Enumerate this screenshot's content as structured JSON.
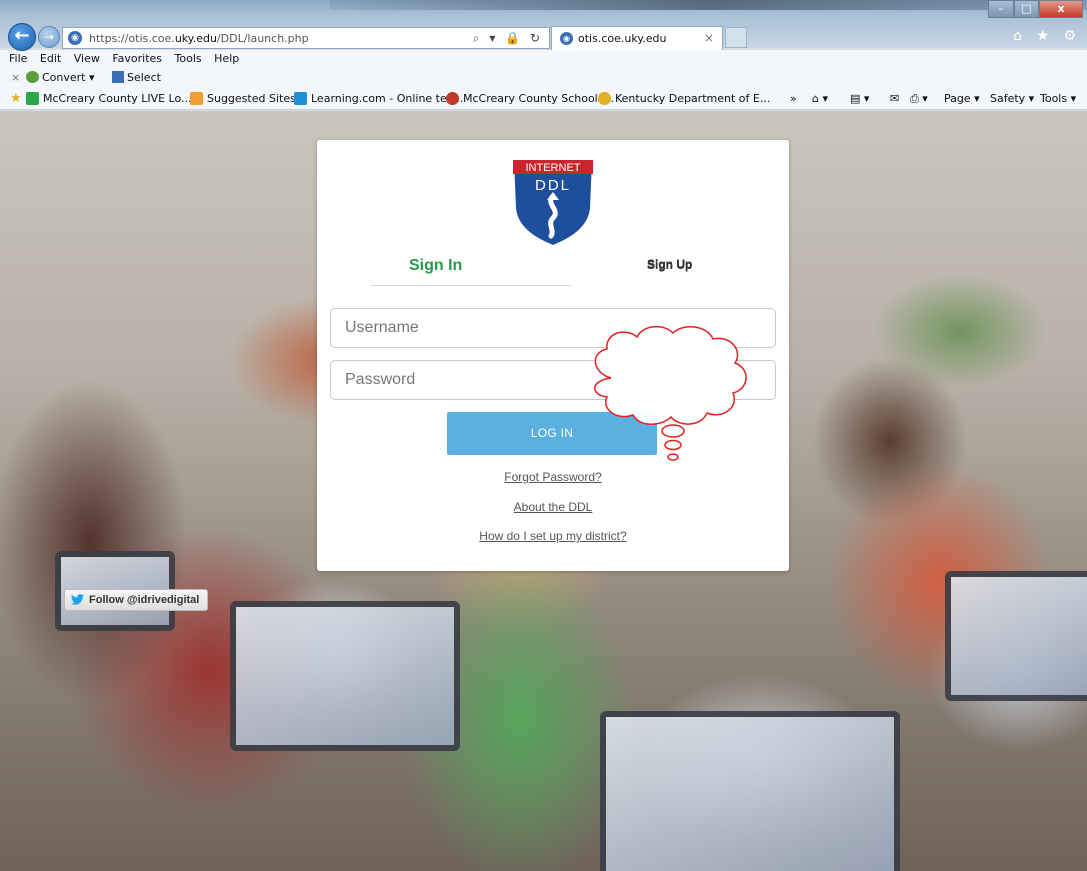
{
  "browser": {
    "url_prefix": "https://otis.coe.",
    "url_domain": "uky.edu",
    "url_path": "/DDL/launch.php",
    "address_tools": "⌕ ▾ 🔒 ↻",
    "tab_title": "otis.coe.uky.edu",
    "tab_close": "×",
    "window_min": "–",
    "window_max": "□",
    "window_close": "x",
    "right_icons": "⌂ ★ ⚙"
  },
  "menu": {
    "items": [
      "File",
      "Edit",
      "View",
      "Favorites",
      "Tools",
      "Help"
    ]
  },
  "command_bar": {
    "close": "×",
    "convert": "Convert ▾",
    "select": "Select"
  },
  "favorites": {
    "items": [
      {
        "label": "McCreary County LIVE Lo...",
        "color": "#2aa84a"
      },
      {
        "label": "Suggested Sites ▾",
        "color": "#f0a030"
      },
      {
        "label": "Learning.com - Online tec...",
        "color": "#1f8fd6"
      },
      {
        "label": "McCreary County Schools...",
        "color": "#c0392b"
      },
      {
        "label": "Kentucky Department of E...",
        "color": "#e0b020"
      }
    ],
    "right_tools": [
      "»",
      "⌂ ▾",
      "▤ ▾",
      "✉",
      "⎙ ▾",
      "Page ▾",
      "Safety ▾",
      "Tools ▾"
    ]
  },
  "login": {
    "logo_top": "INTERNET",
    "logo_main": "DDL",
    "tab_signin": "Sign In",
    "tab_signup": "Sign Up",
    "username_placeholder": "Username",
    "password_placeholder": "Password",
    "login_button": "LOG IN",
    "forgot_link": "Forgot Password?",
    "about_link": "About the DDL",
    "district_link": "How do I set up my district?"
  },
  "twitter": {
    "label": "Follow @idrivedigital"
  },
  "colors": {
    "signin_green": "#2a9a4a",
    "login_button": "#5bb0e0",
    "cloud_outline": "#e02020"
  }
}
